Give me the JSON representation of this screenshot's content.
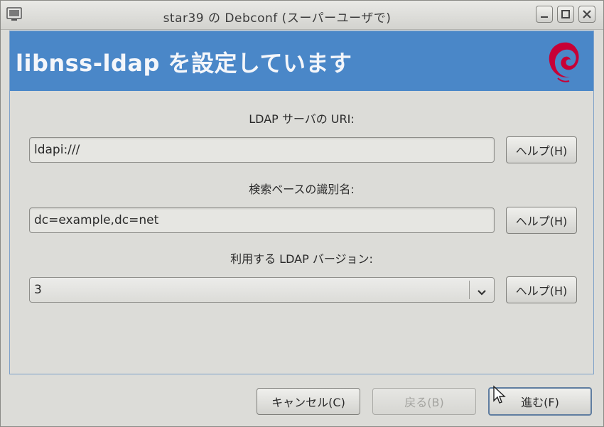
{
  "window": {
    "title": "star39 の Debconf (スーパーユーザで)"
  },
  "banner": {
    "title": "libnss-ldap を設定しています"
  },
  "fields": {
    "uri": {
      "label": "LDAP サーバの URI:",
      "value": "ldapi:///",
      "help": "ヘルプ(H)"
    },
    "base": {
      "label": "検索ベースの識別名:",
      "value": "dc=example,dc=net",
      "help": "ヘルプ(H)"
    },
    "version": {
      "label": "利用する LDAP バージョン:",
      "value": "3",
      "help": "ヘルプ(H)"
    }
  },
  "buttons": {
    "cancel": "キャンセル(C)",
    "back": "戻る(B)",
    "forward": "進む(F)"
  },
  "colors": {
    "banner": "#4a87c8",
    "debian_logo": "#c70036"
  }
}
